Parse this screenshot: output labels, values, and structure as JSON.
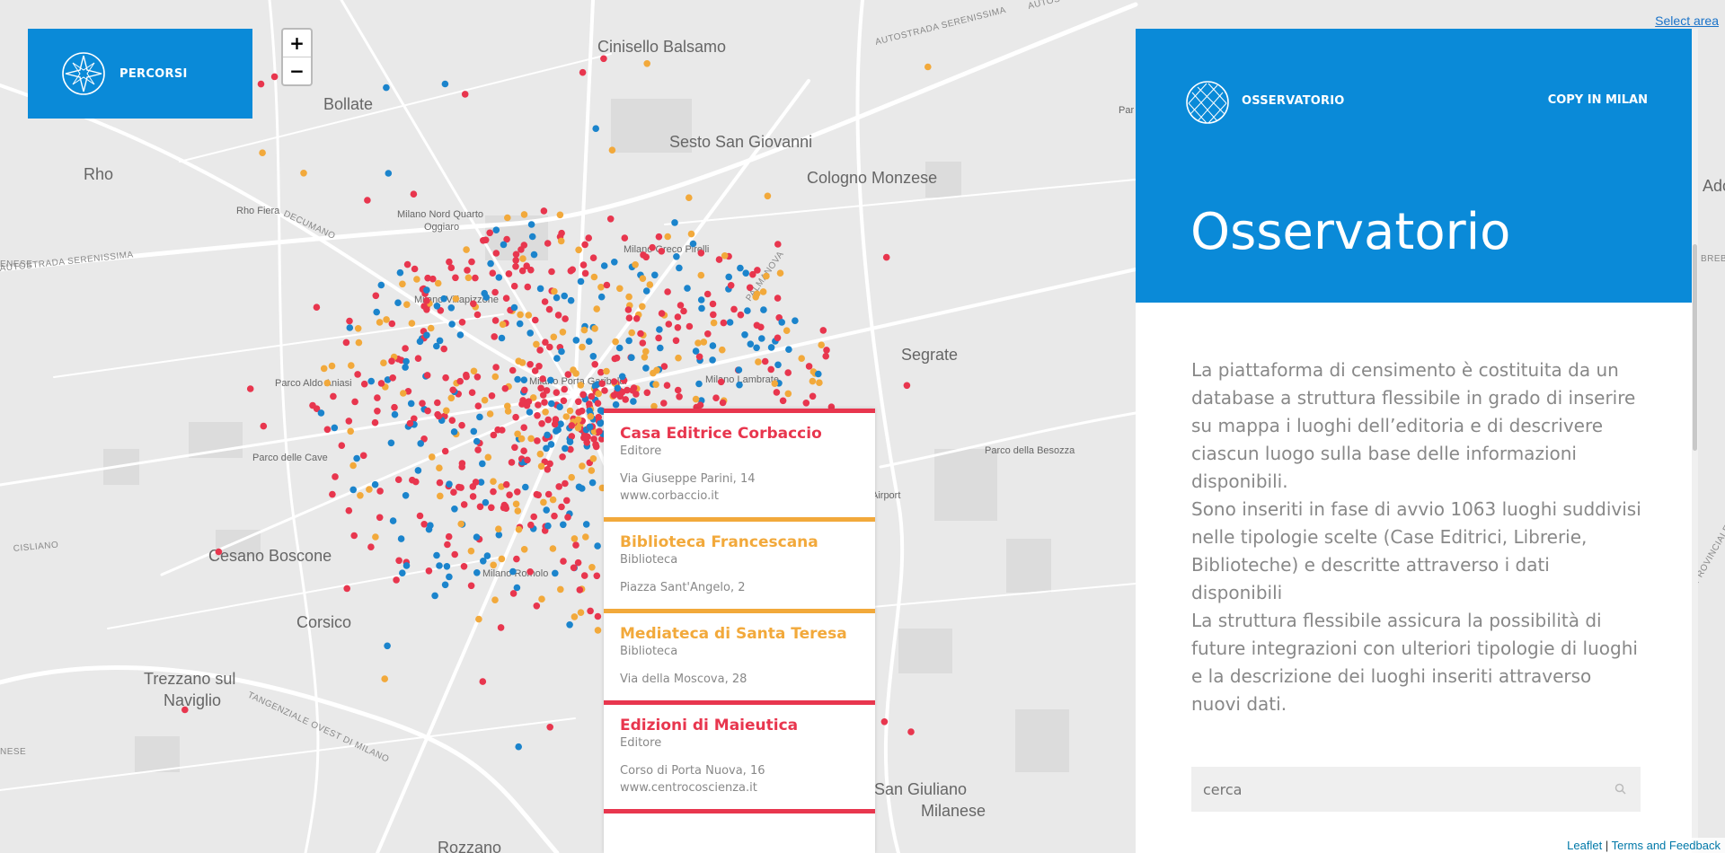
{
  "map": {
    "places": [
      "Cinisello Balsamo",
      "Sesto San Giovanni",
      "Cologno Monzese",
      "Bollate",
      "Rho",
      "Rho Fiera",
      "Milano Nord Quarto Oggiaro",
      "Milano Greco Pirelli",
      "Milano Villapizzone",
      "Segrate",
      "Parco Aldo Aniasi",
      "Milano Porta Garibaldi",
      "Milano Lambrate",
      "Parco delle Cave",
      "Parco della Besozza",
      "Cesano Boscone",
      "Milano Romolo",
      "Corsico",
      "Trezzano sul Naviglio",
      "San Giuliano Milanese",
      "Airport",
      "Rozzano",
      "Par",
      "Ado"
    ],
    "roads": [
      "AUTOSTRADA SERENISSIMA",
      "AUTOSTRADA SERENISSIMA",
      "DECUMANO",
      "TANGENZIALE OVEST DI MILANO",
      "CISLIANO",
      "PALMANOVA",
      "BREBE",
      "PROVINCIALE",
      "ENESE",
      "NESE",
      "AUTOS"
    ],
    "marker_colors": {
      "editore": "#e8364e",
      "biblioteca": "#f2a93b",
      "libreria": "#1b84cc"
    }
  },
  "select_area": "Select area",
  "percorsi": {
    "label": "PERCORSI",
    "icon": "compass-star-icon"
  },
  "zoom": {
    "in": "+",
    "out": "−"
  },
  "popup": [
    {
      "name": "Casa Editrice Corbaccio",
      "type": "Editore",
      "address": "Via Giuseppe Parini, 14",
      "url": "www.corbaccio.it",
      "color": "#e8364e"
    },
    {
      "name": "Biblioteca Francescana",
      "type": "Biblioteca",
      "address": "Piazza Sant'Angelo, 2",
      "url": "",
      "color": "#f2a93b"
    },
    {
      "name": "Mediateca di Santa Teresa",
      "type": "Biblioteca",
      "address": "Via della Moscova, 28",
      "url": "",
      "color": "#f2a93b"
    },
    {
      "name": "Edizioni di Maieutica",
      "type": "Editore",
      "address": "Corso di Porta Nuova, 16",
      "url": "www.centrocoscienza.it",
      "color": "#e8364e"
    }
  ],
  "panel": {
    "brand": "OSSERVATORIO",
    "copy_link": "COPY IN MILAN",
    "title": "Osservatorio",
    "paragraphs": [
      "La piattaforma di censimento è costituita da un database a struttura flessibile in grado di inserire su mappa i luoghi dell’editoria e di descrivere ciascun luogo sulla base delle informazioni disponibili.",
      "Sono inseriti in fase di avvio 1063 luoghi suddivisi nelle tipologie scelte (Case Editrici, Librerie, Biblioteche) e descritte attraverso i dati disponibili",
      "La struttura flessibile assicura la possibilità di future integrazioni con ulteriori tipologie di luoghi e la descrizione dei luoghi inseriti attraverso nuovi dati."
    ],
    "search_placeholder": "cerca",
    "colors": {
      "accent": "#0a8ad8"
    }
  },
  "attribution": {
    "leaflet": "Leaflet",
    "separator": " | ",
    "terms": "Terms and Feedback"
  }
}
